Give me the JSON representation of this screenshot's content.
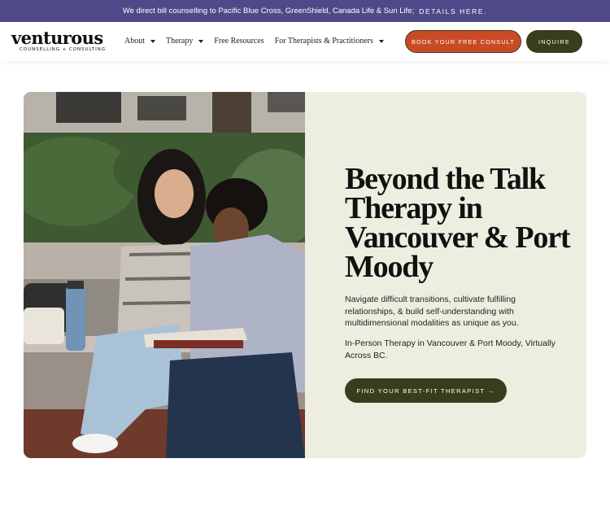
{
  "announcement": {
    "text": "We direct bill counselling to Pacific Blue Cross, GreenShield, Canada Life & Sun Life;",
    "link": "DETAILS HERE."
  },
  "brand": {
    "name": "venturous",
    "tagline": "COUNSELLING + CONSULTING"
  },
  "nav": {
    "items": [
      {
        "label": "About",
        "has_dropdown": true
      },
      {
        "label": "Therapy",
        "has_dropdown": true
      },
      {
        "label": "Free Resources",
        "has_dropdown": false
      },
      {
        "label": "For Therapists & Practitioners",
        "has_dropdown": true
      }
    ],
    "book_label": "BOOK YOUR FREE CONSULT",
    "inquire_label": "INQUIRE"
  },
  "hero": {
    "headline": "Beyond the Talk Therapy in Vancouver & Port Moody",
    "description": "Navigate difficult transitions, cultivate fulfilling relationships, & build self-understanding with multidimensional modalities as unique as you.",
    "locations": "In-Person Therapy in Vancouver & Port Moody, Virtually Across BC.",
    "cta_label": "FIND YOUR BEST-FIT THERAPIST →",
    "photo_icon": "photo-two-women-studying-on-bench"
  },
  "colors": {
    "announcement_bg": "#4e4a8a",
    "book_button": "#c84b26",
    "dark_olive": "#3a3d1c",
    "hero_panel": "#eeeee0"
  }
}
